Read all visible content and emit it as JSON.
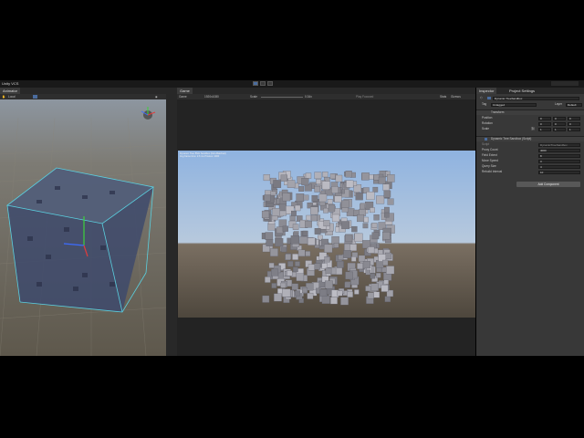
{
  "app": {
    "version": "Unity VCS",
    "colors": {
      "accent": "#4a6c9e",
      "selection": "#5ad0e0",
      "panel": "#383838",
      "sky": "#aac4e6",
      "ground": "#5c5346"
    }
  },
  "scene_panel": {
    "tab_label": "Animator",
    "toolbar": {
      "pivot_label": "Local",
      "toggle_2d": "2D"
    }
  },
  "game_panel": {
    "tab_label": "Game",
    "display_label": "Game",
    "resolution": "1920x1080",
    "scale_label": "Scale",
    "scale_value": "0.34x",
    "play_focused": "Play Focused",
    "stats_label": "Stats",
    "gizmos_label": "Gizmos",
    "overlay_line1": "Dynamic Tree BVH Sandbox (Non-Batched)",
    "overlay_line2": "Avg frame time: 2.6 ms  Proxies: 4000"
  },
  "inspector": {
    "tabs": [
      "Inspector",
      "Project Settings"
    ],
    "object_name": "Dynamic TreeSandbox",
    "tag_label": "Tag",
    "tag_value": "Untagged",
    "layer_label": "Layer",
    "layer_value": "Default",
    "transform": {
      "title": "Transform",
      "position_label": "Position",
      "rotation_label": "Rotation",
      "scale_label": "Scale",
      "position": {
        "x": "0",
        "y": "0",
        "z": "0"
      },
      "rotation": {
        "x": "0",
        "y": "0",
        "z": "0"
      },
      "scale": {
        "x": "1",
        "y": "1",
        "z": "1"
      }
    },
    "script": {
      "title": "Dynamic Tree Sandbox (Script)",
      "script_label": "Script",
      "script_value": "DynamicTreeSandbox",
      "props": [
        {
          "label": "Proxy Count",
          "value": "4000"
        },
        {
          "label": "Field Extent",
          "value": "8"
        },
        {
          "label": "Move Speed",
          "value": "3"
        },
        {
          "label": "Query Size",
          "value": "4"
        },
        {
          "label": "Rebuild Interval",
          "value": "10"
        }
      ]
    },
    "add_component": "Add Component"
  }
}
